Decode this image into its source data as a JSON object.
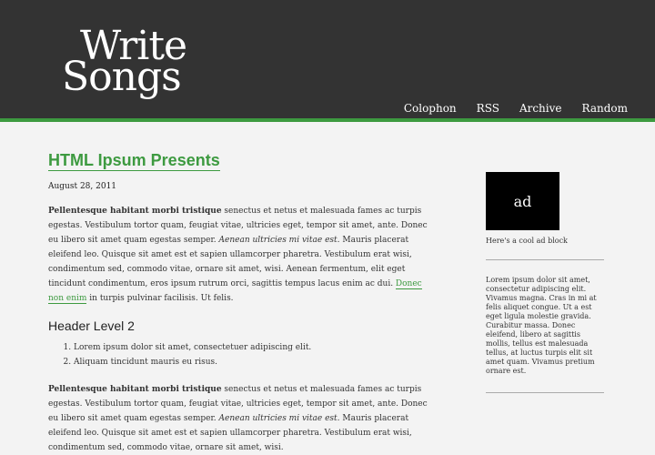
{
  "logo": {
    "line1": "Write",
    "line2": "Songs"
  },
  "nav": [
    "Colophon",
    "RSS",
    "Archive",
    "Random"
  ],
  "post": {
    "title": "HTML Ipsum Presents",
    "date": "August 28, 2011",
    "p1": {
      "bold": "Pellentesque habitant morbi tristique",
      "text1": " senectus et netus et malesuada fames ac turpis egestas. Vestibulum tortor quam, feugiat vitae, ultricies eget, tempor sit amet, ante. Donec eu libero sit amet quam egestas semper. ",
      "italic": "Aenean ultricies mi vitae est.",
      "text2": " Mauris placerat eleifend leo. Quisque sit amet est et sapien ullamcorper pharetra. Vestibulum erat wisi, condimentum sed, commodo vitae, ornare sit amet, wisi. Aenean fermentum, elit eget tincidunt condimentum, eros ipsum rutrum orci, sagittis tempus lacus enim ac dui. ",
      "link": "Donec non enim",
      "text3": " in turpis pulvinar facilisis. Ut felis."
    },
    "h2": "Header Level 2",
    "list": [
      "Lorem ipsum dolor sit amet, consectetuer adipiscing elit.",
      "Aliquam tincidunt mauris eu risus."
    ],
    "p2": {
      "bold": "Pellentesque habitant morbi tristique",
      "text1": " senectus et netus et malesuada fames ac turpis egestas. Vestibulum tortor quam, feugiat vitae, ultricies eget, tempor sit amet, ante. Donec eu libero sit amet quam egestas semper. ",
      "italic": "Aenean ultricies mi vitae est.",
      "text2": " Mauris placerat eleifend leo. Quisque sit amet est et sapien ullamcorper pharetra. Vestibulum erat wisi, condimentum sed, commodo vitae, ornare sit amet, wisi."
    }
  },
  "sidebar": {
    "ad": "ad",
    "ad_caption": "Here's a cool ad block",
    "text": "Lorem ipsum dolor sit amet, consectetur adipiscing elit. Vivamus magna. Cras in mi at felis aliquet congue. Ut a est eget ligula molestie gravida. Curabitur massa. Donec eleifend, libero at sagittis mollis, tellus est malesuada tellus, at luctus turpis elit sit amet quam. Vivamus pretium ornare est."
  },
  "colors": {
    "accent": "#3d9a40",
    "header_bg": "#333333",
    "page_bg": "#f3f3f3"
  }
}
